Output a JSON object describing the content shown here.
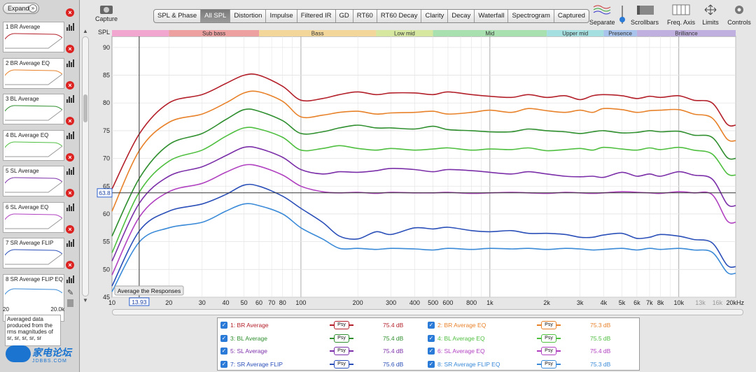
{
  "sidebar": {
    "expand_label": "Expand",
    "measurements": [
      {
        "label": "1 BR Average",
        "color": "#b3202a"
      },
      {
        "label": "2 BR Average EQ",
        "color": "#e8822a"
      },
      {
        "label": "3 BL Average",
        "color": "#2f8f2f"
      },
      {
        "label": "4 BL Average EQ",
        "color": "#4fbf40"
      },
      {
        "label": "5 SL Average",
        "color": "#7b2fa8"
      },
      {
        "label": "6 SL Average EQ",
        "color": "#b040c0"
      },
      {
        "label": "7 SR Average FLIP",
        "color": "#2a4fb8"
      },
      {
        "label": "8 SR Average FLIP EQ",
        "color": "#3a8ad8"
      }
    ],
    "selected_axis": {
      "start": "20",
      "end": "20.0k"
    },
    "info_text": "Averaged data produced from the rms magnitudes of sr, sr, sr, sr, sr",
    "watermark_main": "家电论坛",
    "watermark_sub": "JDBBS.COM"
  },
  "toolbar": {
    "capture_label": "Capture",
    "tabs": [
      "SPL & Phase",
      "All SPL",
      "Distortion",
      "Impulse",
      "Filtered IR",
      "GD",
      "RT60",
      "RT60 Decay",
      "Clarity",
      "Decay",
      "Waterfall",
      "Spectrogram",
      "Captured"
    ],
    "active_tab": "All SPL",
    "right_tools": {
      "separate": "Separate",
      "scrollbars": "Scrollbars",
      "freq_axis": "Freq. Axis",
      "limits": "Limits",
      "controls": "Controls"
    }
  },
  "chart_data": {
    "type": "line",
    "ylabel": "SPL",
    "ylim": [
      45,
      92
    ],
    "yticks": [
      45,
      50,
      55,
      60,
      65,
      70,
      75,
      80,
      85,
      90
    ],
    "xscale": "log",
    "xlim": [
      10,
      20000
    ],
    "xticks": [
      {
        "v": 10,
        "l": "10"
      },
      {
        "v": 20,
        "l": "20"
      },
      {
        "v": 30,
        "l": "30"
      },
      {
        "v": 40,
        "l": "40"
      },
      {
        "v": 50,
        "l": "50"
      },
      {
        "v": 60,
        "l": "60"
      },
      {
        "v": 70,
        "l": "70"
      },
      {
        "v": 80,
        "l": "80"
      },
      {
        "v": 100,
        "l": "100"
      },
      {
        "v": 200,
        "l": "200"
      },
      {
        "v": 300,
        "l": "300"
      },
      {
        "v": 400,
        "l": "400"
      },
      {
        "v": 500,
        "l": "500"
      },
      {
        "v": 600,
        "l": "600"
      },
      {
        "v": 800,
        "l": "800"
      },
      {
        "v": 1000,
        "l": "1k"
      },
      {
        "v": 2000,
        "l": "2k"
      },
      {
        "v": 3000,
        "l": "3k"
      },
      {
        "v": 4000,
        "l": "4k"
      },
      {
        "v": 5000,
        "l": "5k"
      },
      {
        "v": 6000,
        "l": "6k"
      },
      {
        "v": 7000,
        "l": "7k"
      },
      {
        "v": 8000,
        "l": "8k"
      },
      {
        "v": 10000,
        "l": "10k"
      },
      {
        "v": 13000,
        "l": "13k"
      },
      {
        "v": 16000,
        "l": "16k"
      },
      {
        "v": 20000,
        "l": "20kHz"
      }
    ],
    "bands": [
      {
        "name": "",
        "from": 10,
        "to": 20,
        "color": "#f0a6cf"
      },
      {
        "name": "Sub bass",
        "from": 20,
        "to": 60,
        "color": "#eda0a0"
      },
      {
        "name": "Bass",
        "from": 60,
        "to": 250,
        "color": "#f3d79a"
      },
      {
        "name": "Low mid",
        "from": 250,
        "to": 500,
        "color": "#d6e8a0"
      },
      {
        "name": "Mid",
        "from": 500,
        "to": 2000,
        "color": "#a8e0b0"
      },
      {
        "name": "Upper mid",
        "from": 2000,
        "to": 4000,
        "color": "#a6dfe0"
      },
      {
        "name": "Presence",
        "from": 4000,
        "to": 6000,
        "color": "#a8c4ec"
      },
      {
        "name": "Brilliance",
        "from": 6000,
        "to": 20000,
        "color": "#c0b0e0"
      }
    ],
    "cursor": {
      "y_value": "63.8",
      "x_value": "13.93",
      "y": 63.8,
      "x": 13.93
    },
    "annotation": "Average the Responses",
    "freq_points": [
      10,
      14,
      20,
      30,
      40,
      50,
      60,
      80,
      100,
      130,
      160,
      200,
      250,
      300,
      400,
      500,
      600,
      800,
      1000,
      1300,
      1600,
      2000,
      2500,
      3000,
      3500,
      4000,
      5000,
      6000,
      7000,
      8000,
      10000,
      12000,
      15000,
      18000,
      20000
    ],
    "series": [
      {
        "name": "1: BR Average",
        "color": "#b3202a",
        "values": [
          64.5,
          74.5,
          80,
          81.5,
          83.5,
          85,
          85,
          83,
          80.5,
          80.8,
          81.5,
          82,
          81.5,
          81.8,
          81.8,
          81.5,
          82,
          81.5,
          81.2,
          81,
          81.5,
          81,
          81.3,
          80.6,
          81.3,
          81.5,
          81.3,
          80.8,
          81.2,
          81,
          81.3,
          80.5,
          80,
          76.2,
          76
        ]
      },
      {
        "name": "2: BR Average EQ",
        "color": "#e8822a",
        "values": [
          60.5,
          71.5,
          76.5,
          78,
          80,
          81.8,
          82,
          80.3,
          77.5,
          77.8,
          78.3,
          78.5,
          78,
          78.2,
          78.3,
          78.5,
          78,
          78.3,
          78.7,
          78.3,
          79,
          78.6,
          78.3,
          78.7,
          78.3,
          79,
          78.8,
          78.3,
          78.6,
          78.7,
          78.8,
          78,
          77.3,
          73.5,
          73.2
        ]
      },
      {
        "name": "3: BL Average",
        "color": "#2f8f2f",
        "values": [
          56,
          66.5,
          72.5,
          74.5,
          77,
          78.8,
          78.5,
          76.8,
          74.5,
          74.8,
          75.5,
          76,
          75.5,
          75.5,
          75.3,
          75.8,
          75.2,
          75,
          74.8,
          74.8,
          75.3,
          75,
          74.8,
          74.5,
          74.8,
          75,
          74.6,
          74.7,
          75,
          74.8,
          74.9,
          74.2,
          73.8,
          70.2,
          70
        ]
      },
      {
        "name": "4: BL Average EQ",
        "color": "#4fbf40",
        "values": [
          53,
          64,
          69.5,
          71.5,
          74,
          75.5,
          75.3,
          73.8,
          71.5,
          71.8,
          72.3,
          71.8,
          71.5,
          71.8,
          71.5,
          71.7,
          71.9,
          71.5,
          71.7,
          71.6,
          71.9,
          71.4,
          71.6,
          71.8,
          71.5,
          72,
          71.7,
          71.5,
          71.9,
          71.6,
          72,
          71.5,
          70.8,
          67.3,
          67
        ]
      },
      {
        "name": "5: SL Average",
        "color": "#7b2fa8",
        "values": [
          51.5,
          62,
          66.8,
          68.5,
          70.5,
          72,
          71.8,
          70.2,
          68,
          67.2,
          67.6,
          67.5,
          67.8,
          68.2,
          68,
          67.6,
          68,
          67.8,
          67.5,
          67.2,
          67.6,
          67.2,
          66.8,
          66.7,
          66.8,
          66.6,
          67.5,
          66.8,
          67.2,
          66.8,
          67.6,
          67,
          66.3,
          61.8,
          61.5
        ]
      },
      {
        "name": "6: SL Average EQ",
        "color": "#b040c0",
        "values": [
          49,
          59.5,
          64,
          65.5,
          67.5,
          68.8,
          68.6,
          67,
          65,
          64,
          63.8,
          63.9,
          63.7,
          63.9,
          63.8,
          63.8,
          63.9,
          63.7,
          63.8,
          63.9,
          63.8,
          63.7,
          63.9,
          63.8,
          63.7,
          63.8,
          64,
          63.9,
          63.8,
          63.7,
          64,
          63.8,
          63.5,
          58.8,
          58.5
        ]
      },
      {
        "name": "7: SR Average FLIP",
        "color": "#2a4fb8",
        "values": [
          47,
          57,
          60.5,
          61.8,
          63.5,
          65.2,
          65,
          63.2,
          61,
          58.5,
          56,
          55.5,
          56.8,
          56.3,
          57.5,
          57.3,
          57.6,
          57,
          56.8,
          57,
          56.5,
          56.5,
          56.3,
          55.8,
          55.8,
          56.2,
          56.5,
          55.6,
          55.8,
          56.3,
          56,
          55.4,
          54.8,
          50.8,
          50.5
        ]
      },
      {
        "name": "8: SR Average FLIP EQ",
        "color": "#3a8ad8",
        "values": [
          46,
          55,
          57.5,
          58.5,
          60.5,
          61.8,
          61.5,
          60,
          57.5,
          55.5,
          53.8,
          53.8,
          53.6,
          53.8,
          53.7,
          53.5,
          53.8,
          53.6,
          53.8,
          53.7,
          53.8,
          53.6,
          53.8,
          53.7,
          53.5,
          53.6,
          53.8,
          53.5,
          53.8,
          53.6,
          53.8,
          53.5,
          53.1,
          49.5,
          49.3
        ]
      }
    ]
  },
  "legend": {
    "psy_label": "Psy",
    "items": [
      {
        "label": "1: BR Average",
        "value": "75.4 dB",
        "color": "#b3202a"
      },
      {
        "label": "2: BR Average EQ",
        "value": "75.3 dB",
        "color": "#e8822a"
      },
      {
        "label": "3: BL Average",
        "value": "75.4 dB",
        "color": "#2f8f2f"
      },
      {
        "label": "4: BL Average EQ",
        "value": "75.5 dB",
        "color": "#4fbf40"
      },
      {
        "label": "5: SL Average",
        "value": "75.4 dB",
        "color": "#7b2fa8"
      },
      {
        "label": "6: SL Average EQ",
        "value": "75.4 dB",
        "color": "#b040c0"
      },
      {
        "label": "7: SR Average FLIP",
        "value": "75.6 dB",
        "color": "#2a4fb8"
      },
      {
        "label": "8: SR Average FLIP EQ",
        "value": "75.3 dB",
        "color": "#3a8ad8"
      }
    ]
  }
}
